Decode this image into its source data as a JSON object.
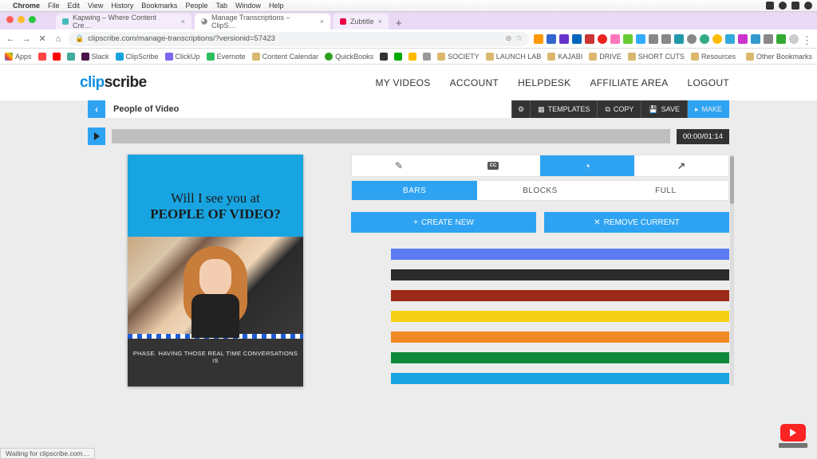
{
  "mac_menu": {
    "app": "Chrome",
    "items": [
      "File",
      "Edit",
      "View",
      "History",
      "Bookmarks",
      "People",
      "Tab",
      "Window",
      "Help"
    ]
  },
  "tabs": [
    {
      "title": "Kapwing – Where Content Cre…"
    },
    {
      "title": "Manage Transcriptions – ClipS…"
    },
    {
      "title": "Zubtitle"
    }
  ],
  "address": {
    "url": "clipscribe.com/manage-transcriptions/?versionid=57423"
  },
  "bookmarks": {
    "apps": "Apps",
    "items": [
      "",
      "",
      "",
      "Slack",
      "ClipScribe",
      "ClickUp",
      "Evernote",
      "Content Calendar",
      "QuickBooks",
      "",
      "",
      "",
      "SOCIETY",
      "LAUNCH LAB",
      "KAJABI",
      "DRIVE",
      "SHORT CUTS",
      "Resources"
    ],
    "other": "Other Bookmarks"
  },
  "cs_nav": [
    "MY VIDEOS",
    "ACCOUNT",
    "HELPDESK",
    "AFFILIATE AREA",
    "LOGOUT"
  ],
  "cs_logo": {
    "a": "clip",
    "b": "scribe"
  },
  "project": {
    "title": "People of Video"
  },
  "proj_actions": {
    "templates": "TEMPLATES",
    "copy": "COPY",
    "save": "SAVE",
    "make": "MAKE"
  },
  "timecode": "00:00/01:14",
  "preview": {
    "line1": "Will I see you at",
    "line2": "PEOPLE OF VIDEO?",
    "subtitle": "PHASE. HAVING THOSE REAL TIME CONVERSATIONS IS"
  },
  "style_tabs": {
    "bars": "BARS",
    "blocks": "BLOCKS",
    "full": "FULL"
  },
  "actions": {
    "create": "CREATE NEW",
    "remove": "REMOVE CURRENT"
  },
  "bar_colors": [
    "#5b7bf0",
    "#2b2b2b",
    "#9c2a17",
    "#f4d115",
    "#f08a24",
    "#0f8a3c",
    "#1aa4e0"
  ],
  "status": "Waiting for clipscribe.com…",
  "tool_tabs_cc": "CC"
}
